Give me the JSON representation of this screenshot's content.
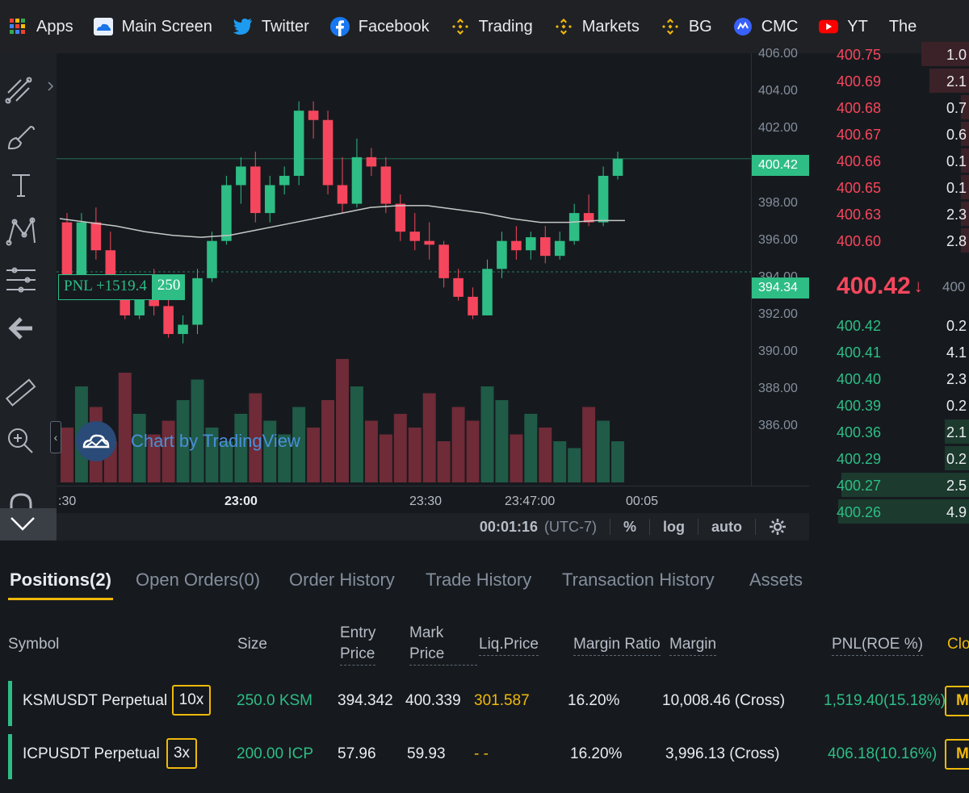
{
  "bookmarks": [
    {
      "label": "Apps",
      "icon": "apps-grid-icon"
    },
    {
      "label": "Main Screen",
      "icon": "cloud-icon"
    },
    {
      "label": "Twitter",
      "icon": "twitter-icon"
    },
    {
      "label": "Facebook",
      "icon": "facebook-icon"
    },
    {
      "label": "Trading",
      "icon": "binance-icon"
    },
    {
      "label": "Markets",
      "icon": "binance-icon"
    },
    {
      "label": "BG",
      "icon": "binance-icon"
    },
    {
      "label": "CMC",
      "icon": "coinmarketcap-icon"
    },
    {
      "label": "YT",
      "icon": "youtube-icon"
    },
    {
      "label": "The",
      "icon": ""
    }
  ],
  "chart": {
    "price_ticks": [
      "406.00",
      "404.00",
      "402.00",
      "400.00",
      "398.00",
      "396.00",
      "394.00",
      "392.00",
      "390.00",
      "388.00",
      "386.00"
    ],
    "last_price_tag": "400.42",
    "entry_price_tag": "394.34",
    "pnl_label": "PNL +1519.4",
    "pnl_qty": "250",
    "watermark": "Chart by TradingView",
    "time_ticks": [
      ":30",
      "23:00",
      "23:30",
      "23:47:00",
      "00:05"
    ],
    "status": {
      "clock": "00:01:16",
      "tz": "(UTC-7)",
      "pct": "%",
      "log": "log",
      "auto": "auto"
    },
    "ma_color": "#c7c7c7",
    "up_color": "#2ebd85",
    "down_color": "#f6465d"
  },
  "chart_data": {
    "type": "candlestick",
    "ylim": [
      384.5,
      406.0
    ],
    "ma_line": [
      397.2,
      397.0,
      396.8,
      396.5,
      396.3,
      396.2,
      396.3,
      396.6,
      396.9,
      397.2,
      397.5,
      397.8,
      397.9,
      397.9,
      397.7,
      397.5,
      397.2,
      397.0,
      397.0,
      397.1,
      397.1
    ],
    "candles": [
      {
        "o": 397.0,
        "h": 397.5,
        "c": 394.0,
        "l": 393.5
      },
      {
        "o": 394.0,
        "h": 397.5,
        "c": 397.0,
        "l": 393.8
      },
      {
        "o": 397.0,
        "h": 397.8,
        "c": 395.5,
        "l": 395.0
      },
      {
        "o": 395.5,
        "h": 396.5,
        "c": 393.5,
        "l": 393.0
      },
      {
        "o": 393.5,
        "h": 394.0,
        "c": 392.0,
        "l": 391.8
      },
      {
        "o": 392.0,
        "h": 393.8,
        "c": 393.5,
        "l": 391.8
      },
      {
        "o": 393.5,
        "h": 394.5,
        "c": 392.5,
        "l": 392.0
      },
      {
        "o": 392.5,
        "h": 393.0,
        "c": 391.0,
        "l": 390.8
      },
      {
        "o": 391.0,
        "h": 392.0,
        "c": 391.5,
        "l": 390.5
      },
      {
        "o": 391.5,
        "h": 394.5,
        "c": 394.0,
        "l": 391.0
      },
      {
        "o": 394.0,
        "h": 396.5,
        "c": 396.0,
        "l": 393.8
      },
      {
        "o": 396.0,
        "h": 399.5,
        "c": 399.0,
        "l": 395.8
      },
      {
        "o": 399.0,
        "h": 400.5,
        "c": 400.0,
        "l": 398.0
      },
      {
        "o": 400.0,
        "h": 400.8,
        "c": 397.5,
        "l": 397.0
      },
      {
        "o": 397.5,
        "h": 399.5,
        "c": 399.0,
        "l": 397.0
      },
      {
        "o": 399.0,
        "h": 400.0,
        "c": 399.5,
        "l": 398.5
      },
      {
        "o": 399.5,
        "h": 403.5,
        "c": 403.0,
        "l": 399.0
      },
      {
        "o": 403.0,
        "h": 403.5,
        "c": 402.5,
        "l": 401.5
      },
      {
        "o": 402.5,
        "h": 403.0,
        "c": 399.0,
        "l": 398.5
      },
      {
        "o": 399.0,
        "h": 400.5,
        "c": 398.0,
        "l": 397.5
      },
      {
        "o": 398.0,
        "h": 401.5,
        "c": 400.5,
        "l": 397.8
      },
      {
        "o": 400.5,
        "h": 401.0,
        "c": 400.0,
        "l": 399.5
      },
      {
        "o": 400.0,
        "h": 400.5,
        "c": 398.0,
        "l": 397.5
      },
      {
        "o": 398.0,
        "h": 398.5,
        "c": 396.5,
        "l": 396.0
      },
      {
        "o": 396.5,
        "h": 397.5,
        "c": 396.0,
        "l": 395.5
      },
      {
        "o": 396.0,
        "h": 397.0,
        "c": 395.8,
        "l": 395.0
      },
      {
        "o": 395.8,
        "h": 396.0,
        "c": 394.0,
        "l": 393.5
      },
      {
        "o": 394.0,
        "h": 394.5,
        "c": 393.0,
        "l": 392.8
      },
      {
        "o": 393.0,
        "h": 393.5,
        "c": 392.0,
        "l": 391.8
      },
      {
        "o": 392.0,
        "h": 395.0,
        "c": 394.5,
        "l": 392.0
      },
      {
        "o": 394.5,
        "h": 396.5,
        "c": 396.0,
        "l": 394.0
      },
      {
        "o": 396.0,
        "h": 396.8,
        "c": 395.5,
        "l": 395.0
      },
      {
        "o": 395.5,
        "h": 396.5,
        "c": 396.2,
        "l": 395.0
      },
      {
        "o": 396.2,
        "h": 396.8,
        "c": 395.2,
        "l": 394.8
      },
      {
        "o": 395.2,
        "h": 396.5,
        "c": 396.0,
        "l": 395.0
      },
      {
        "o": 396.0,
        "h": 398.0,
        "c": 397.5,
        "l": 395.8
      },
      {
        "o": 397.5,
        "h": 398.5,
        "c": 397.0,
        "l": 396.8
      },
      {
        "o": 397.0,
        "h": 400.0,
        "c": 399.5,
        "l": 396.8
      },
      {
        "o": 399.5,
        "h": 400.8,
        "c": 400.42,
        "l": 399.3
      }
    ],
    "volume_max": 100,
    "volume": [
      40,
      70,
      55,
      30,
      80,
      50,
      35,
      45,
      60,
      75,
      40,
      30,
      50,
      65,
      45,
      35,
      55,
      40,
      60,
      90,
      70,
      45,
      35,
      50,
      40,
      65,
      30,
      55,
      45,
      70,
      60,
      35,
      50,
      40,
      30,
      25,
      55,
      45,
      30
    ]
  },
  "orderbook": {
    "asks": [
      {
        "price": "400.75",
        "size": "1.0",
        "depth": 0.3
      },
      {
        "price": "400.69",
        "size": "2.1",
        "depth": 0.25
      },
      {
        "price": "400.68",
        "size": "0.7",
        "depth": 0.05
      },
      {
        "price": "400.67",
        "size": "0.6",
        "depth": 0.05
      },
      {
        "price": "400.66",
        "size": "0.1",
        "depth": 0.05
      },
      {
        "price": "400.65",
        "size": "0.1",
        "depth": 0.05
      },
      {
        "price": "400.63",
        "size": "2.3",
        "depth": 0.05
      },
      {
        "price": "400.60",
        "size": "2.8",
        "depth": 0.05
      }
    ],
    "last_price": "400.42",
    "last_arrow": "↓",
    "mark_price": "400",
    "bids": [
      {
        "price": "400.42",
        "size": "0.2",
        "depth": 0.0
      },
      {
        "price": "400.41",
        "size": "4.1",
        "depth": 0.0
      },
      {
        "price": "400.40",
        "size": "2.3",
        "depth": 0.0
      },
      {
        "price": "400.39",
        "size": "0.2",
        "depth": 0.0
      },
      {
        "price": "400.36",
        "size": "2.1",
        "depth": 0.15
      },
      {
        "price": "400.29",
        "size": "0.2",
        "depth": 0.15
      },
      {
        "price": "400.27",
        "size": "2.5",
        "depth": 0.8
      },
      {
        "price": "400.26",
        "size": "4.9",
        "depth": 0.82
      }
    ]
  },
  "tabs": [
    {
      "label": "Positions(2)",
      "active": true
    },
    {
      "label": "Open Orders(0)",
      "active": false
    },
    {
      "label": "Order History",
      "active": false
    },
    {
      "label": "Trade History",
      "active": false
    },
    {
      "label": "Transaction History",
      "active": false
    },
    {
      "label": "Assets",
      "active": false
    }
  ],
  "positions": {
    "headers": {
      "symbol": "Symbol",
      "size": "Size",
      "entry_1": "Entry",
      "entry_2": "Price",
      "mark_1": "Mark",
      "mark_2": "Price",
      "liq": "Liq.Price",
      "margin_ratio": "Margin Ratio",
      "margin": "Margin",
      "pnl": "PNL(ROE %)",
      "close": "Clo"
    },
    "rows": [
      {
        "symbol": "KSMUSDT Perpetual",
        "leverage": "10x",
        "size": "250.0 KSM",
        "entry": "394.342",
        "mark": "400.339",
        "liq": "301.587",
        "margin_ratio": "16.20%",
        "margin": "10,008.46 (Cross)",
        "pnl": "1,519.40(15.18%)",
        "close": "M"
      },
      {
        "symbol": "ICPUSDT Perpetual",
        "leverage": "3x",
        "size": "200.00 ICP",
        "entry": "57.96",
        "mark": "59.93",
        "liq": "- -",
        "margin_ratio": "16.20%",
        "margin": "3,996.13 (Cross)",
        "pnl": "406.18(10.16%)",
        "close": "M"
      }
    ]
  }
}
